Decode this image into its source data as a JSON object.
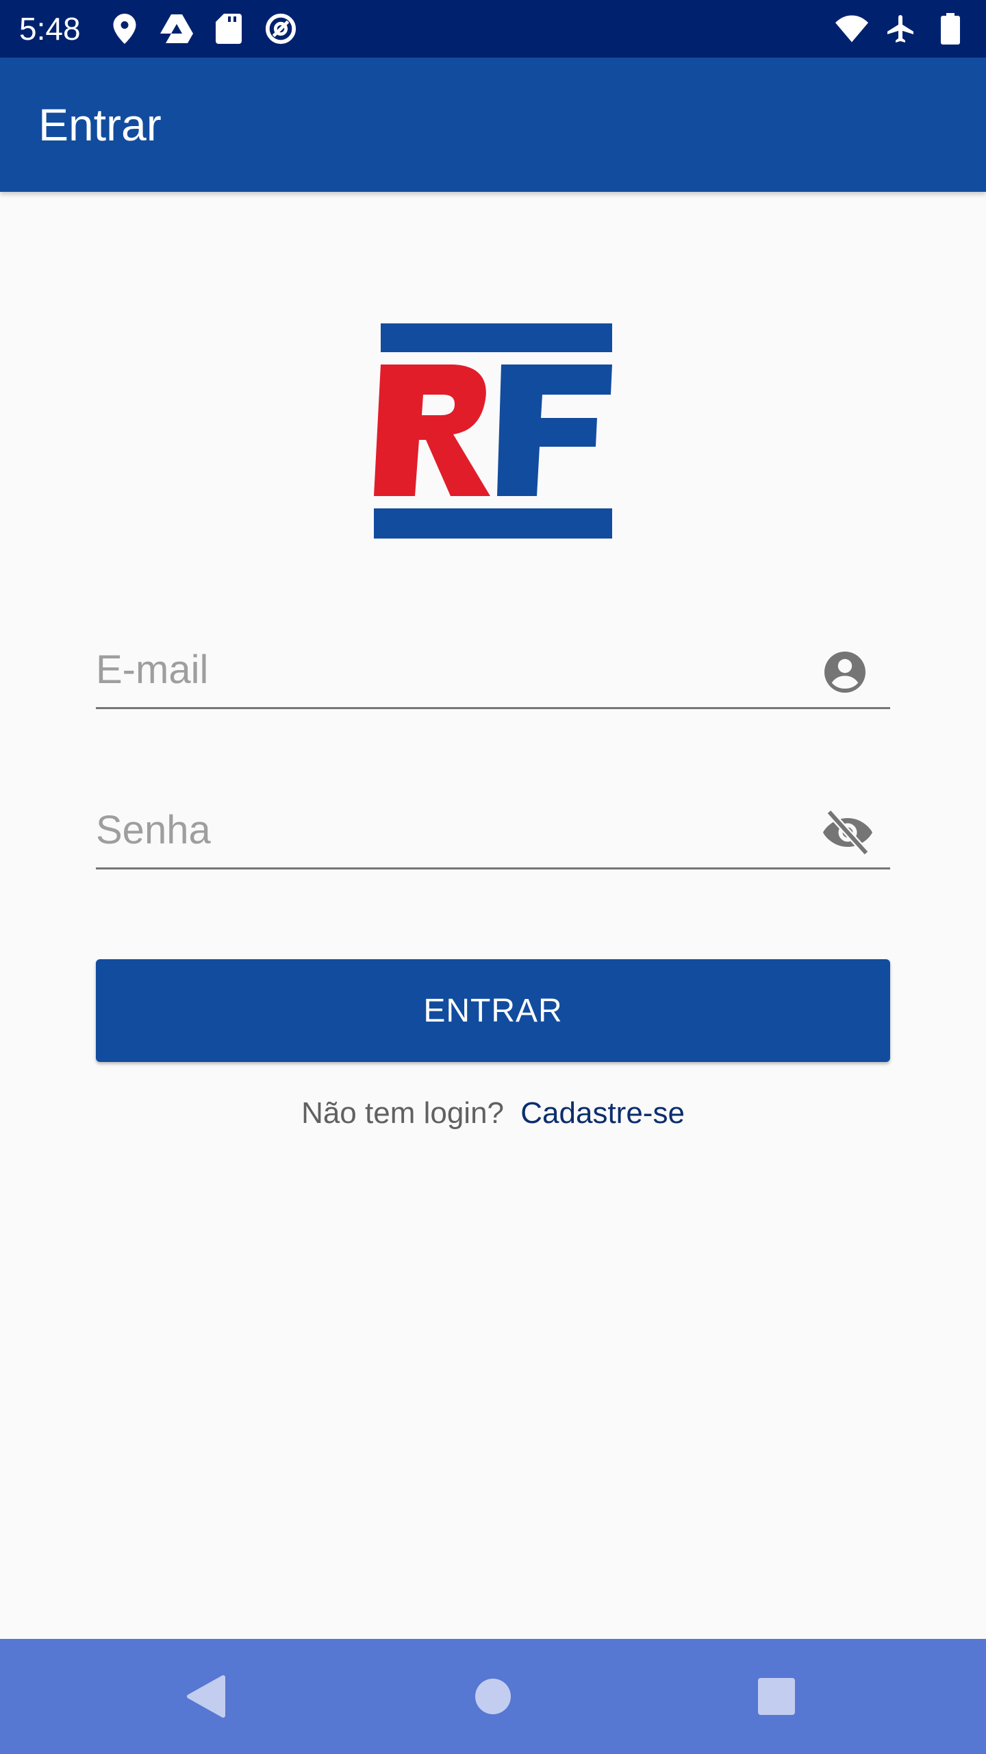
{
  "status_bar": {
    "time": "5:48",
    "left_icons": [
      "location-icon",
      "drive-icon",
      "sd-card-icon",
      "data-saver-icon"
    ],
    "right_icons": [
      "wifi-icon",
      "airplane-icon",
      "battery-icon"
    ]
  },
  "app_bar": {
    "title": "Entrar"
  },
  "logo": {
    "text": "RF",
    "colors": {
      "blue": "#124c9e",
      "red": "#e11d2a"
    }
  },
  "form": {
    "email": {
      "placeholder": "E-mail",
      "value": "",
      "icon": "account-circle-icon"
    },
    "password": {
      "placeholder": "Senha",
      "value": "",
      "icon": "visibility-off-icon"
    },
    "submit_label": "ENTRAR"
  },
  "signup": {
    "prompt": "Não tem login?",
    "link": "Cadastre-se"
  },
  "nav_bar": {
    "buttons": [
      "back-icon",
      "home-icon",
      "recents-icon"
    ]
  },
  "colors": {
    "status_bar": "#00226e",
    "primary": "#124c9e",
    "nav_bar": "#5677d2",
    "background": "#fafafa"
  }
}
